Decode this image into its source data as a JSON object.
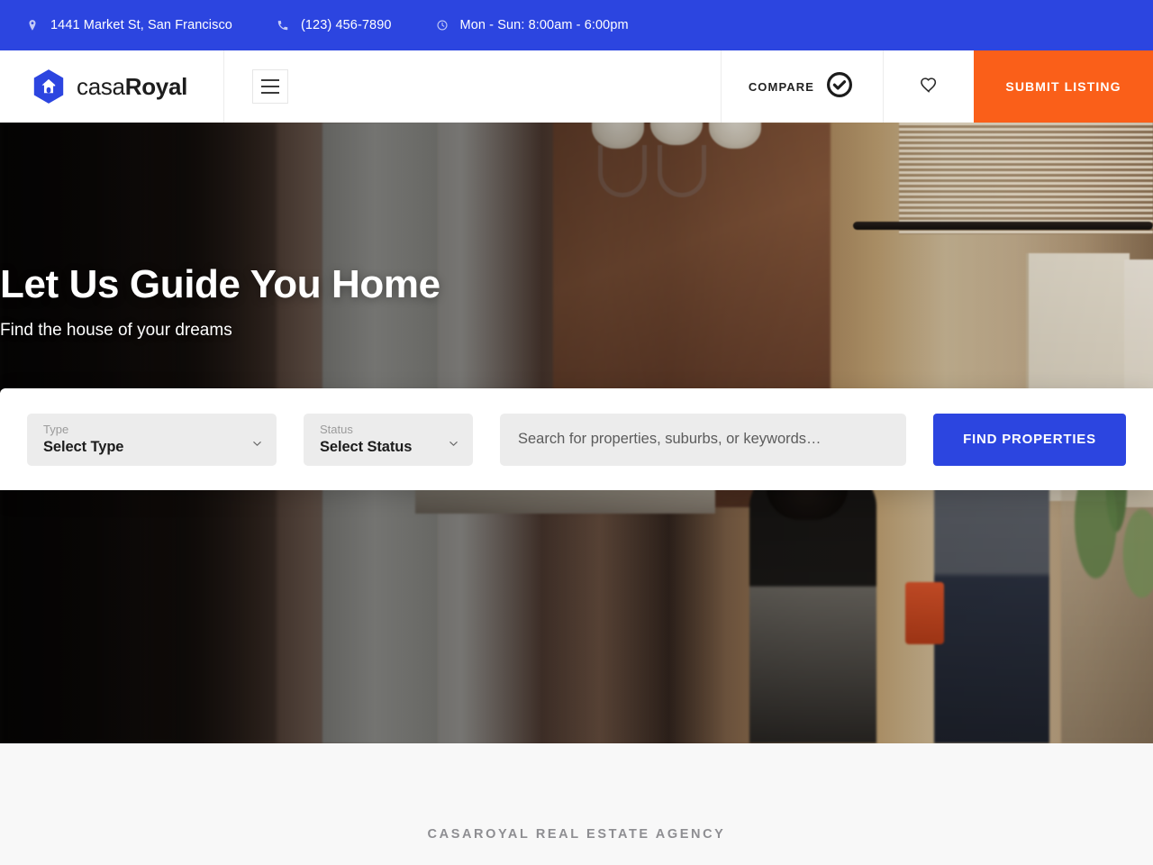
{
  "topbar": {
    "items": [
      {
        "icon": "map-pin-icon",
        "text": "1441 Market St, San Francisco"
      },
      {
        "icon": "phone-icon",
        "text": "(123) 456-7890"
      },
      {
        "icon": "clock-icon",
        "text": "Mon - Sun: 8:00am - 6:00pm"
      }
    ],
    "background_color": "#2c45e0"
  },
  "header": {
    "logo": {
      "name_light": "casa",
      "name_bold": "Royal",
      "icon": "hexagon-house-icon"
    },
    "menu_button": {
      "icon": "hamburger-icon"
    },
    "compare": {
      "label": "COMPARE",
      "icon": "check-circle-icon"
    },
    "favorites": {
      "icon": "heart-icon"
    },
    "submit_listing": {
      "label": "SUBMIT LISTING",
      "color": "#fa5f19"
    }
  },
  "hero": {
    "title": "Let Us Guide You Home",
    "subtitle": "Find the house of your dreams"
  },
  "search": {
    "type_field": {
      "label": "Type",
      "value": "Select Type",
      "chevron": "chevron-down-icon"
    },
    "status_field": {
      "label": "Status",
      "value": "Select Status",
      "chevron": "chevron-down-icon"
    },
    "keyword_placeholder": "Search for properties, suburbs, or keywords…",
    "keyword_value": "",
    "submit_label": "FIND PROPERTIES",
    "submit_color": "#2c45e0"
  },
  "agency": {
    "heading": "CASAROYAL REAL ESTATE AGENCY"
  }
}
